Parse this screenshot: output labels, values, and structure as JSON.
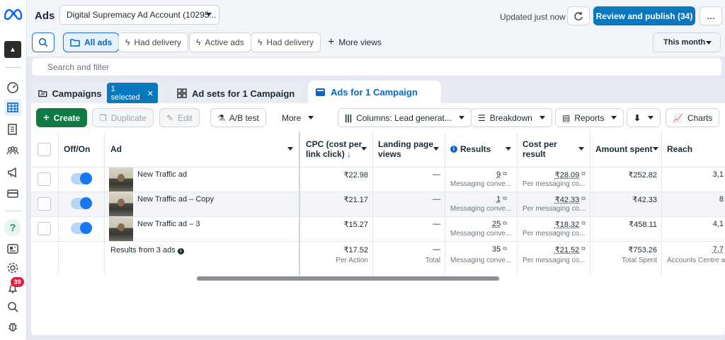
{
  "app": {
    "title": "Ads"
  },
  "account": {
    "name": "Digital Supremacy Ad Account (10295..."
  },
  "status": {
    "updated": "Updated just now"
  },
  "actions": {
    "review_publish": "Review and publish (34)",
    "more": "…"
  },
  "views": {
    "all_ads": "All ads",
    "had_delivery_1": "Had delivery",
    "active_ads": "Active ads",
    "had_delivery_2": "Had delivery",
    "more_views": "More views",
    "date_range": "This month"
  },
  "search": {
    "placeholder": "Search and filter"
  },
  "tabs": {
    "campaigns": "Campaigns",
    "selected": "1 selected",
    "ad_sets": "Ad sets for 1 Campaign",
    "ads": "Ads for 1 Campaign"
  },
  "toolbar": {
    "create": "Create",
    "duplicate": "Duplicate",
    "edit": "Edit",
    "ab_test": "A/B test",
    "more": "More",
    "columns": "Columns: Lead generat...",
    "breakdown": "Breakdown",
    "reports": "Reports",
    "charts": "Charts"
  },
  "rail": {
    "notifications": "39"
  },
  "table": {
    "headers": {
      "off_on": "Off/On",
      "ad": "Ad",
      "cpc": "CPC (cost per link click)",
      "landing": "Landing page views",
      "results": "Results",
      "cost_per_result": "Cost per result",
      "amount_spent": "Amount spent",
      "reach": "Reach"
    },
    "rows": [
      {
        "name": "New Traffic ad",
        "cpc": "₹22.98",
        "landing": "—",
        "results": "9",
        "results_sub": "Messaging conve...",
        "cpr": "₹28.09",
        "cpr_sub": "Per messaging co...",
        "spent": "₹252.82",
        "reach": "3,1"
      },
      {
        "name": "New Traffic ad – Copy",
        "cpc": "₹21.17",
        "landing": "—",
        "results": "1",
        "results_sub": "Messaging conve...",
        "cpr": "₹42.33",
        "cpr_sub": "Per messaging co...",
        "spent": "₹42.33",
        "reach": "8"
      },
      {
        "name": "New Traffic ad – 3",
        "cpc": "₹15.27",
        "landing": "—",
        "results": "25",
        "results_sub": "Messaging conve...",
        "cpr": "₹18.32",
        "cpr_sub": "Per messaging co...",
        "spent": "₹458.11",
        "reach": "4,1"
      }
    ],
    "summary": {
      "label": "Results from 3 ads",
      "cpc": "₹17.52",
      "cpc_sub": "Per Action",
      "landing": "—",
      "landing_sub": "Total",
      "results": "35",
      "results_sub": "Messaging conve...",
      "cpr": "₹21.52",
      "cpr_sub": "Per messaging co...",
      "spent": "₹753.26",
      "spent_sub": "Total Spent",
      "reach": "7,7",
      "reach_sub": "Accounts Centre ac"
    }
  },
  "colors": {
    "accent": "#0a78be",
    "create": "#107a45",
    "badge": "#e41e3f"
  }
}
